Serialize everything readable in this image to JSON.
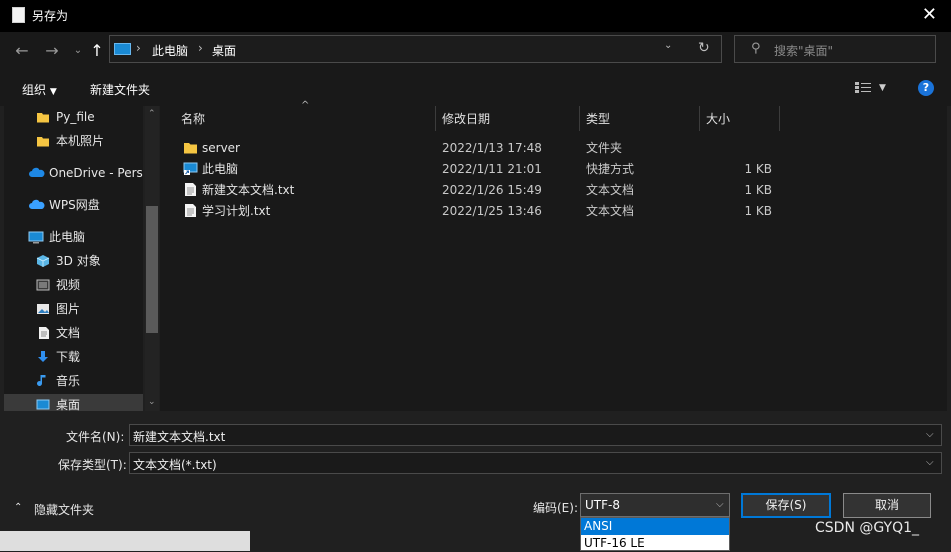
{
  "window": {
    "title": "另存为"
  },
  "address": {
    "segments": [
      "此电脑",
      "桌面"
    ]
  },
  "search": {
    "placeholder": "搜索\"桌面\""
  },
  "toolbar": {
    "organize": "组织",
    "new_folder": "新建文件夹",
    "help": "?"
  },
  "sidebar": {
    "items": [
      {
        "label": "Py_file",
        "icon": "folder-icon"
      },
      {
        "label": "本机照片",
        "icon": "folder-icon"
      },
      {
        "label": "OneDrive - Personal",
        "icon": "cloud-icon"
      },
      {
        "label": "WPS网盘",
        "icon": "cloud-icon"
      },
      {
        "label": "此电脑",
        "icon": "computer-icon"
      },
      {
        "label": "3D 对象",
        "icon": "cube-icon"
      },
      {
        "label": "视频",
        "icon": "video-icon"
      },
      {
        "label": "图片",
        "icon": "picture-icon"
      },
      {
        "label": "文档",
        "icon": "document-icon"
      },
      {
        "label": "下载",
        "icon": "download-icon"
      },
      {
        "label": "音乐",
        "icon": "music-icon"
      },
      {
        "label": "桌面",
        "icon": "desktop-icon"
      }
    ]
  },
  "table": {
    "columns": [
      "名称",
      "修改日期",
      "类型",
      "大小"
    ],
    "rows": [
      {
        "name": "server",
        "date": "2022/1/13 17:48",
        "type": "文件夹",
        "size": "",
        "icon": "folder-icon"
      },
      {
        "name": "此电脑",
        "date": "2022/1/11 21:01",
        "type": "快捷方式",
        "size": "1 KB",
        "icon": "shortcut-icon"
      },
      {
        "name": "新建文本文档.txt",
        "date": "2022/1/26 15:49",
        "type": "文本文档",
        "size": "1 KB",
        "icon": "text-file-icon"
      },
      {
        "name": "学习计划.txt",
        "date": "2022/1/25 13:46",
        "type": "文本文档",
        "size": "1 KB",
        "icon": "text-file-icon"
      }
    ]
  },
  "form": {
    "filename_label": "文件名(N):",
    "filename_value": "新建文本文档.txt",
    "filetype_label": "保存类型(T):",
    "filetype_value": "文本文档(*.txt)",
    "hide_folders": "隐藏文件夹",
    "encoding_label": "编码(E):",
    "encoding_value": "UTF-8",
    "encoding_options": [
      "ANSI",
      "UTF-16 LE"
    ],
    "save": "保存(S)",
    "cancel": "取消"
  },
  "watermark": "CSDN @GYQ1_",
  "colors": {
    "accent": "#0078d7",
    "background": "#191919",
    "selected": "#3a3a3a"
  }
}
